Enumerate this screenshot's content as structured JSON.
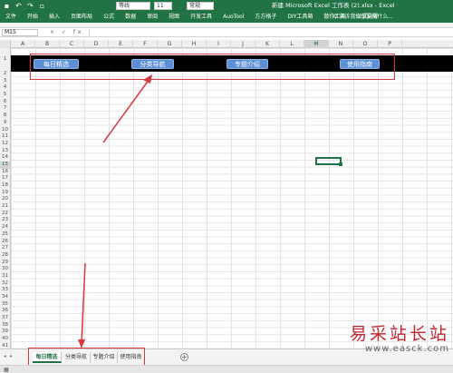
{
  "window": {
    "title": "新建 Microsoft Excel 工作表 (2).xlsx - Excel",
    "font_name": "等线",
    "font_size": "11",
    "number_format": "常规"
  },
  "qat_icons": [
    "save-icon",
    "undo-icon",
    "redo-icon",
    "open-icon"
  ],
  "ribbon": {
    "tabs": [
      "文件",
      "开始",
      "插入",
      "页面布局",
      "公式",
      "数据",
      "审阅",
      "视图",
      "开发工具",
      "AuoTool",
      "方方格子",
      "DIY工具箱",
      "散你工具",
      "公式向导"
    ],
    "tell_me": "告诉我你想要做什么..."
  },
  "formula_bar": {
    "name_box": "M15",
    "fx_symbols": "× ✓ fx"
  },
  "columns": [
    "A",
    "B",
    "C",
    "D",
    "E",
    "F",
    "G",
    "H",
    "I",
    "J",
    "K",
    "L",
    "M",
    "N",
    "O",
    "P"
  ],
  "selected_column": "M",
  "rows": [
    "1",
    "2",
    "3",
    "4",
    "5",
    "6",
    "7",
    "8",
    "9",
    "10",
    "11",
    "12",
    "13",
    "14",
    "15",
    "16",
    "17",
    "18",
    "19",
    "20",
    "21",
    "22",
    "23",
    "24",
    "25",
    "26",
    "27",
    "28",
    "29",
    "30",
    "31",
    "32",
    "33",
    "34",
    "35",
    "36",
    "37",
    "38",
    "39",
    "40",
    "41",
    "42",
    "43"
  ],
  "selected_row": "15",
  "nav_buttons": [
    "每日精选",
    "分类导航",
    "专题介绍",
    "使用指南"
  ],
  "sheet_tabs": [
    "每日精选",
    "分类导航",
    "专题介绍",
    "使用指南"
  ],
  "active_sheet": "每日精选",
  "watermark": {
    "text": "易采站长站",
    "url": "www.easck.com"
  },
  "colors": {
    "excel_green": "#217346",
    "button_blue": "#5b8fd6",
    "annotation_red": "#d9363e"
  }
}
